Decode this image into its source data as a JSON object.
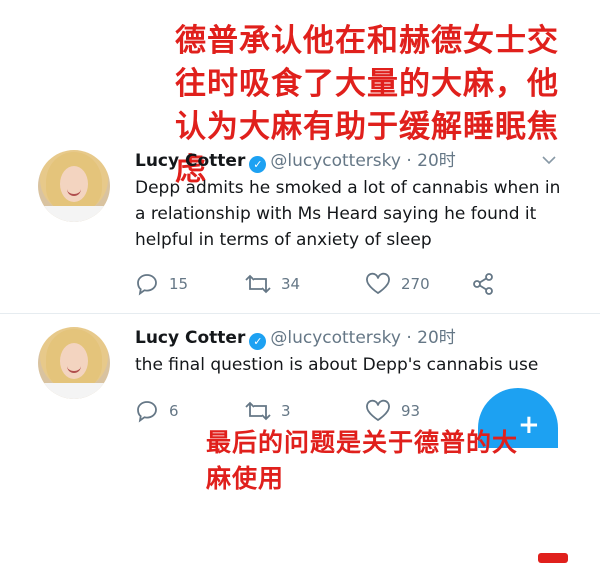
{
  "captions": {
    "top": "德普承认他在和赫德女士交往时吸食了大量的大麻，他认为大麻有助于缓解睡眠焦虑",
    "bottom": "最后的问题是关于德普的大麻使用"
  },
  "tweets": [
    {
      "name": "Lucy Cotter",
      "verified": "✓",
      "handle": "@lucycottersky · 20时",
      "text": "Depp admits he smoked a lot of cannabis when in a relationship with Ms Heard saying he found it helpful in terms of anxiety of sleep",
      "replies": "15",
      "retweets": "34",
      "likes": "270"
    },
    {
      "name": "Lucy Cotter",
      "verified": "✓",
      "handle": "@lucycottersky · 20时",
      "text": "the final question is about Depp's cannabis use",
      "replies": "6",
      "retweets": "3",
      "likes": "93"
    }
  ],
  "icons": {
    "reply": "reply-icon",
    "retweet": "retweet-icon",
    "like": "heart-icon",
    "share": "share-icon",
    "menu": "chevron-down-icon",
    "compose": "compose-plus-icon"
  },
  "colors": {
    "caption": "#e0201c",
    "verified": "#1da1f2",
    "secondary": "#657786"
  }
}
